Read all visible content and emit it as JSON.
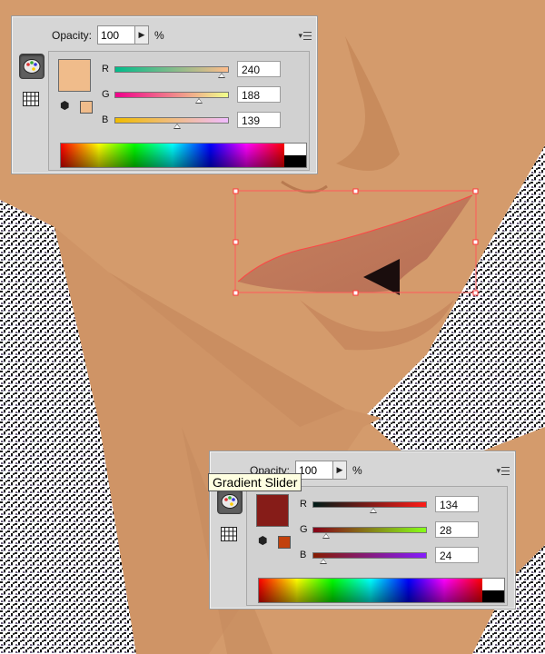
{
  "panel_top": {
    "opacity_label": "Opacity:",
    "opacity_value": "100",
    "percent_label": "%",
    "swatch_color": "#f0bc8b",
    "small_swatch_color": "#f0bc8b",
    "channels": [
      {
        "label": "R",
        "value": "240",
        "level": 0.94,
        "gradient": "linear-gradient(to right,#00bc8b,#ffbc8b)"
      },
      {
        "label": "G",
        "value": "188",
        "level": 0.74,
        "gradient": "linear-gradient(to right,#f0008b,#f0ff8b)"
      },
      {
        "label": "B",
        "value": "139",
        "level": 0.55,
        "gradient": "linear-gradient(to right,#f0bc00,#f0bcff)"
      }
    ]
  },
  "panel_bottom": {
    "opacity_label": "Opacity:",
    "opacity_value": "100",
    "percent_label": "%",
    "tooltip": "Gradient Slider",
    "swatch_color": "#861c18",
    "small_swatch_color": "#c2410c",
    "channels": [
      {
        "label": "R",
        "value": "134",
        "level": 0.53,
        "gradient": "linear-gradient(to right,#001c18,#ff1c18)"
      },
      {
        "label": "G",
        "value": "28",
        "level": 0.11,
        "gradient": "linear-gradient(to right,#860018,#86ff18)"
      },
      {
        "label": "B",
        "value": "24",
        "level": 0.09,
        "gradient": "linear-gradient(to right,#861c00,#861cff)"
      }
    ]
  },
  "icons": {
    "panel_tool_1": "color-palette-icon",
    "panel_tool_2": "swatches-grid-icon",
    "web_safe": "cube-icon",
    "menu": "panel-menu-icon"
  }
}
